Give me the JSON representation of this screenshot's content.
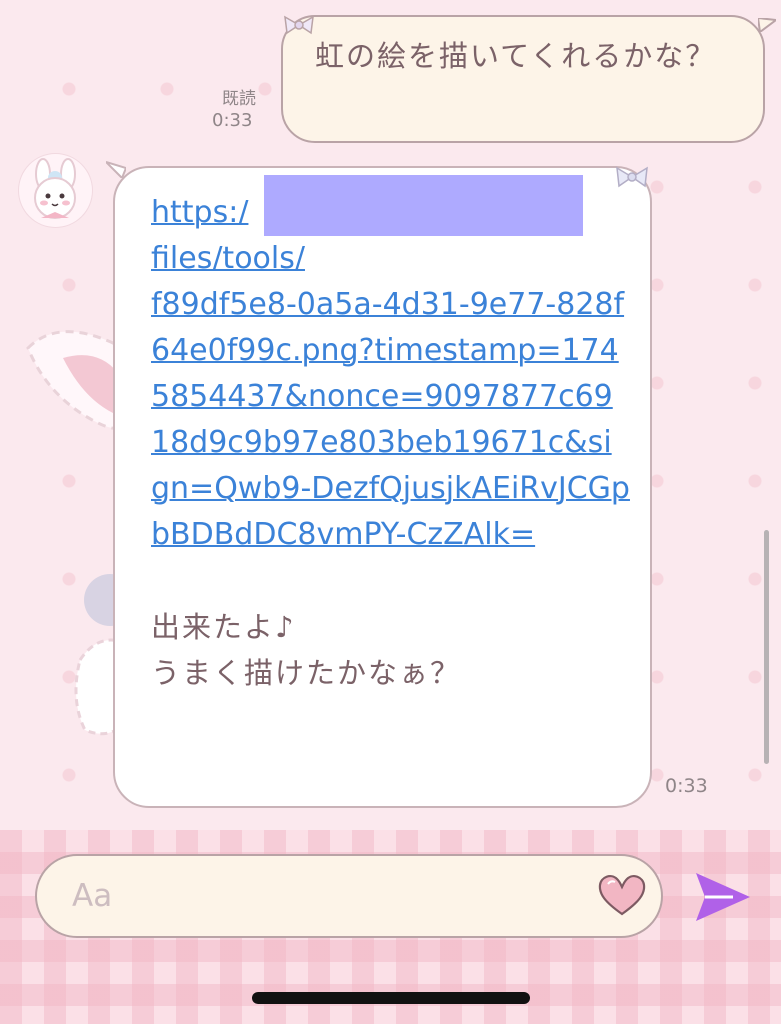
{
  "chat": {
    "outgoing": {
      "text": "虹の絵を描いてくれるかな？",
      "read_label": "既読",
      "time": "0:33"
    },
    "incoming": {
      "link_text": "https:/\nfiles/tools/\nf89df5e8-0a5a-4d31-9e77-828f64e0f99c.png?timestamp=1745854437&nonce=9097877c6918d9c9b97e803beb19671c&sign=Qwb9-DezfQjusjkAEiRvJCGpbBDBdDC8vmPY-CzZAlk=",
      "message": "出来たよ♪\nうまく描けたかなぁ？",
      "time": "0:33"
    }
  },
  "composer": {
    "placeholder": "Aa"
  },
  "colors": {
    "background": "#fbe9ee",
    "bubble_out": "#fdf4e8",
    "bubble_in": "#ffffff",
    "link": "#3b82d8",
    "text": "#7b6268",
    "send": "#b061e8"
  },
  "icons": [
    "heart-icon",
    "send-icon",
    "bow-icon"
  ]
}
